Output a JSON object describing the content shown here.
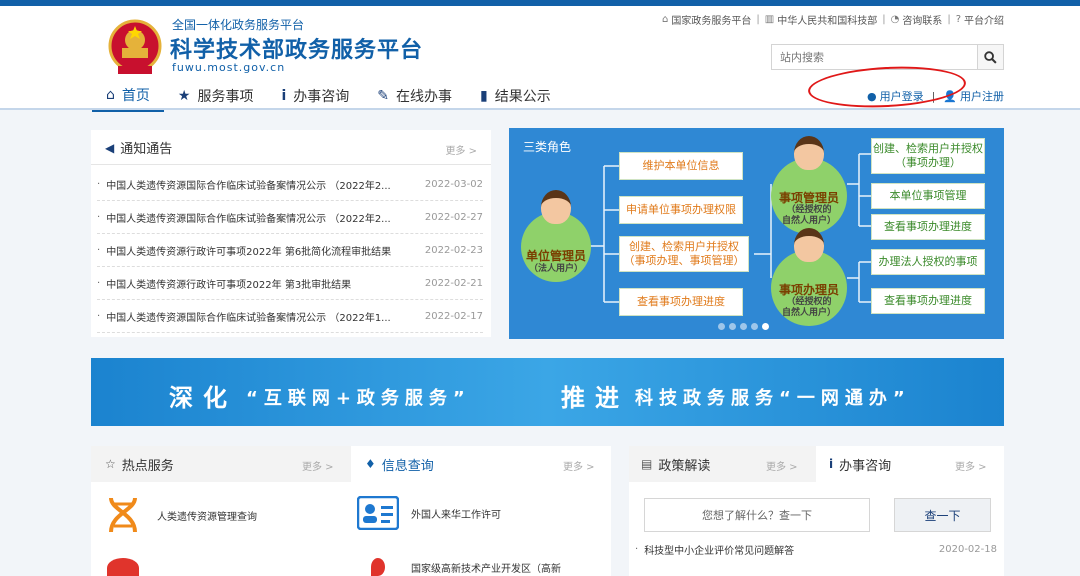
{
  "header": {
    "subtitle": "全国一体化政务服务平台",
    "title": "科学技术部政务服务平台",
    "domain": "fuwu.most.gov.cn",
    "toplinks": [
      "国家政务服务平台",
      "中华人民共和国科技部",
      "咨询联系",
      "平台介绍"
    ],
    "search_placeholder": "站内搜索",
    "nav": [
      "首页",
      "服务事项",
      "办事咨询",
      "在线办事",
      "结果公示"
    ],
    "login": "用户登录",
    "register": "用户注册"
  },
  "notice": {
    "title": "通知通告",
    "more": "更多 >",
    "items": [
      {
        "title": "中国人类遗传资源国际合作临床试验备案情况公示 （2022年2...",
        "date": "2022-03-02"
      },
      {
        "title": "中国人类遗传资源国际合作临床试验备案情况公示 （2022年2...",
        "date": "2022-02-27"
      },
      {
        "title": "中国人类遗传资源行政许可事项2022年 第6批简化流程审批结果",
        "date": "2022-02-23"
      },
      {
        "title": "中国人类遗传资源行政许可事项2022年 第3批审批结果",
        "date": "2022-02-21"
      },
      {
        "title": "中国人类遗传资源国际合作临床试验备案情况公示 （2022年1...",
        "date": "2022-02-17"
      }
    ]
  },
  "roles": {
    "heading": "三类角色",
    "unit_admin": {
      "name": "单位管理员",
      "sub": "（法人用户）"
    },
    "matter_admin": {
      "name": "事项管理员",
      "sub1": "（经授权的",
      "sub2": "自然人用户）"
    },
    "matter_handler": {
      "name": "事项办理员",
      "sub1": "（经授权的",
      "sub2": "自然人用户）"
    },
    "left_boxes": [
      "维护本单位信息",
      "申请单位事项办理权限",
      "创建、检索用户并授权（事项办理、事项管理）",
      "查看事项办理进度"
    ],
    "right_boxes": [
      "创建、检索用户并授权（事项办理）",
      "本单位事项管理",
      "查看事项办理进度",
      "办理法人授权的事项",
      "查看事项办理进度"
    ],
    "active_dot": 4
  },
  "banner": {
    "part1": "深化",
    "part2": "“互联网+政务服务”",
    "part3": "推进",
    "part4": "科技政务服务“一网通办”"
  },
  "services": {
    "tab1": "热点服务",
    "tab2": "信息查询",
    "more": "更多 >",
    "items": [
      "人类遗传资源管理查询",
      "外国人来华工作许可",
      "国家级高新技术产业开发区（高新"
    ]
  },
  "policy": {
    "tab1": "政策解读",
    "tab2": "办事咨询",
    "more": "更多 >",
    "ask_placeholder": "您想了解什么？查一下",
    "ask_button": "查一下",
    "row_title": "科技型中小企业评价常见问题解答",
    "row_date": "2020-02-18"
  },
  "colors": {
    "brand": "#1160a8",
    "annotation": "#e01818",
    "role_bg": "#2f88d4",
    "role_green": "#3a8a2a",
    "role_orange": "#e07a1a"
  }
}
